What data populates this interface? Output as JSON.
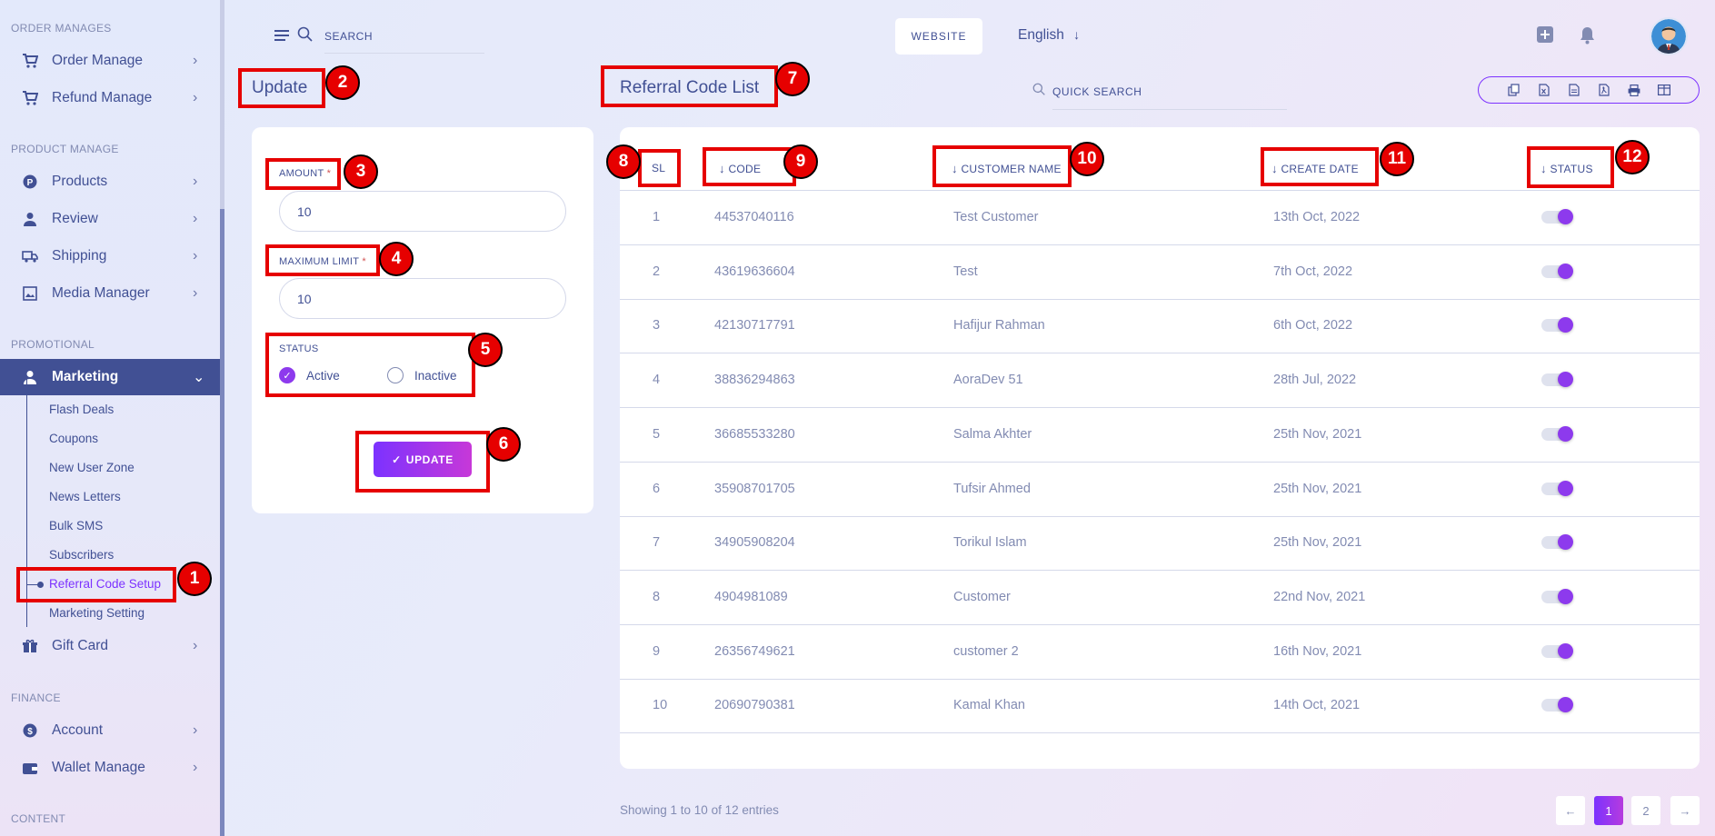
{
  "sidebar": {
    "sections": {
      "order_manages": "ORDER MANAGES",
      "product_manage": "PRODUCT MANAGE",
      "promotional": "PROMOTIONAL",
      "finance": "FINANCE",
      "content": "CONTENT"
    },
    "items": [
      {
        "label": "Order Manage",
        "icon": "cart-icon"
      },
      {
        "label": "Refund Manage",
        "icon": "cart-icon"
      },
      {
        "label": "Products",
        "icon": "product-icon"
      },
      {
        "label": "Review",
        "icon": "user-icon"
      },
      {
        "label": "Shipping",
        "icon": "truck-icon"
      },
      {
        "label": "Media Manager",
        "icon": "image-icon"
      },
      {
        "label": "Marketing",
        "icon": "user-icon"
      },
      {
        "label": "Gift Card",
        "icon": "gift-icon"
      },
      {
        "label": "Account",
        "icon": "dollar-icon"
      },
      {
        "label": "Wallet Manage",
        "icon": "wallet-icon"
      }
    ],
    "marketing_sub": [
      "Flash Deals",
      "Coupons",
      "New User Zone",
      "News Letters",
      "Bulk SMS",
      "Subscribers",
      "Referral Code Setup",
      "Marketing Setting"
    ]
  },
  "header": {
    "search_placeholder": "SEARCH",
    "website_label": "WEBSITE",
    "language": "English"
  },
  "update_form": {
    "title": "Update",
    "amount_label": "AMOUNT",
    "amount_value": "10",
    "max_limit_label": "MAXIMUM LIMIT",
    "max_limit_value": "10",
    "required_mark": "*",
    "status_label": "STATUS",
    "active_label": "Active",
    "inactive_label": "Inactive",
    "status_selected": "Active",
    "update_button": "UPDATE"
  },
  "list": {
    "title": "Referral Code List",
    "quick_search_placeholder": "QUICK SEARCH",
    "columns": [
      "SL",
      "CODE",
      "CUSTOMER NAME",
      "CREATE DATE",
      "STATUS"
    ],
    "rows": [
      {
        "sl": "1",
        "code": "44537040116",
        "customer": "Test Customer",
        "date": "13th Oct, 2022",
        "status": true
      },
      {
        "sl": "2",
        "code": "43619636604",
        "customer": "Test",
        "date": "7th Oct, 2022",
        "status": true
      },
      {
        "sl": "3",
        "code": "42130717791",
        "customer": "Hafijur Rahman",
        "date": "6th Oct, 2022",
        "status": true
      },
      {
        "sl": "4",
        "code": "38836294863",
        "customer": "AoraDev 51",
        "date": "28th Jul, 2022",
        "status": true
      },
      {
        "sl": "5",
        "code": "36685533280",
        "customer": "Salma Akhter",
        "date": "25th Nov, 2021",
        "status": true
      },
      {
        "sl": "6",
        "code": "35908701705",
        "customer": "Tufsir Ahmed",
        "date": "25th Nov, 2021",
        "status": true
      },
      {
        "sl": "7",
        "code": "34905908204",
        "customer": "Torikul Islam",
        "date": "25th Nov, 2021",
        "status": true
      },
      {
        "sl": "8",
        "code": "4904981089",
        "customer": "Customer",
        "date": "22nd Nov, 2021",
        "status": true
      },
      {
        "sl": "9",
        "code": "26356749621",
        "customer": "customer 2",
        "date": "16th Nov, 2021",
        "status": true
      },
      {
        "sl": "10",
        "code": "20690790381",
        "customer": "Kamal Khan",
        "date": "14th Oct, 2021",
        "status": true
      }
    ],
    "showing_text": "Showing 1 to 10 of 12 entries",
    "pages": [
      "1",
      "2"
    ],
    "current_page": "1"
  },
  "annotations": [
    "1",
    "2",
    "3",
    "4",
    "5",
    "6",
    "7",
    "8",
    "9",
    "10",
    "11",
    "12"
  ],
  "colors": {
    "primary": "#415094",
    "accent": "#7c32ff",
    "purple": "#8d3aed",
    "annotation_red": "#e60000"
  }
}
